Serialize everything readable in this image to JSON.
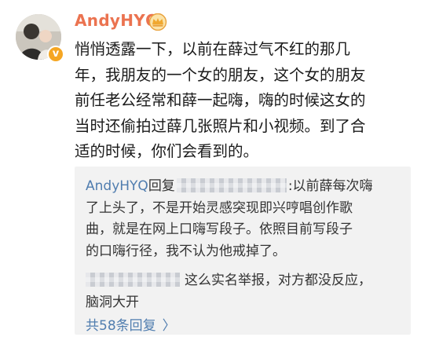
{
  "post": {
    "username": "AndyHYQ",
    "avatar_icon": "user-avatar",
    "badge_icon": "verified-v-icon",
    "badge_text": "v",
    "crown_icon": "crown-icon",
    "body_lines": [
      "悄悄透露一下，以前在薛过气不红的那几",
      "年，我朋友的一个女的朋友，这个女的朋友",
      "前任老公经常和薛一起嗨，嗨的时候这女的",
      "当时还偷拍过薛几张照片和小视频。到了合",
      "适的时候，你们会看到的。"
    ]
  },
  "replies": {
    "reply_1": {
      "author": "AndyHYQ",
      "reply_word": "回复",
      "first_line_rest": ":以前薛每次嗨",
      "lines": [
        "了上头了，不是开始灵感突现即兴哼唱创作歌",
        "曲，就是在网上口嗨写段子。依照目前写段子",
        "的口嗨行径，我不认为他戒掉了。"
      ]
    },
    "reply_2": {
      "first_line_rest": "这么实名举报，对方都没反应，",
      "second_line": "脑洞大开"
    },
    "more_replies_label": "共58条回复",
    "more_icon": "chevron-right-icon",
    "more_arrow": "〉"
  },
  "colors": {
    "username": "#eb7350",
    "link": "#507daf",
    "body_text": "#1a1a1a",
    "reply_text": "#333333",
    "reply_bg": "#f2f2f2",
    "badge": "#f5a623"
  }
}
